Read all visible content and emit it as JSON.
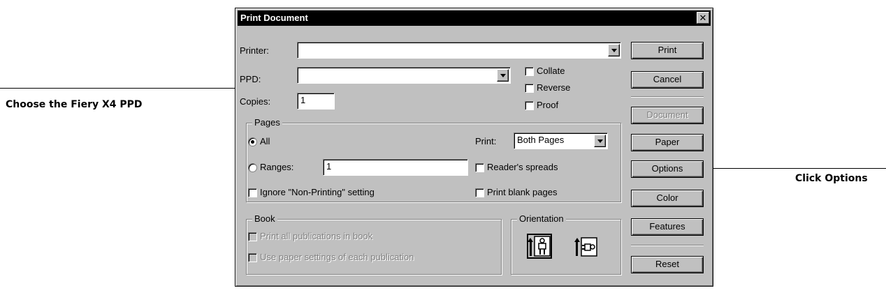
{
  "callouts": {
    "left": "Choose the Fiery X4 PPD",
    "right": "Click Options"
  },
  "dialog": {
    "title": "Print Document",
    "close_glyph": "✕",
    "printer_label": "Printer:",
    "printer_value": "",
    "ppd_label": "PPD:",
    "ppd_value": "",
    "copies_label": "Copies:",
    "copies_value": "1",
    "collate_label": "Collate",
    "reverse_label": "Reverse",
    "proof_label": "Proof",
    "pages": {
      "title": "Pages",
      "all_label": "All",
      "ranges_label": "Ranges:",
      "ranges_value": "1",
      "ignore_label": "Ignore \"Non-Printing\" setting",
      "print_label": "Print:",
      "print_value": "Both Pages",
      "readers_label": "Reader's spreads",
      "blank_label": "Print blank pages"
    },
    "book": {
      "title": "Book",
      "print_all_label": "Print all publications in book",
      "use_paper_label": "Use paper settings of each publication"
    },
    "orientation": {
      "title": "Orientation"
    },
    "buttons": {
      "print": "Print",
      "cancel": "Cancel",
      "document": "Document",
      "paper": "Paper",
      "options": "Options",
      "color": "Color",
      "features": "Features",
      "reset": "Reset"
    }
  }
}
